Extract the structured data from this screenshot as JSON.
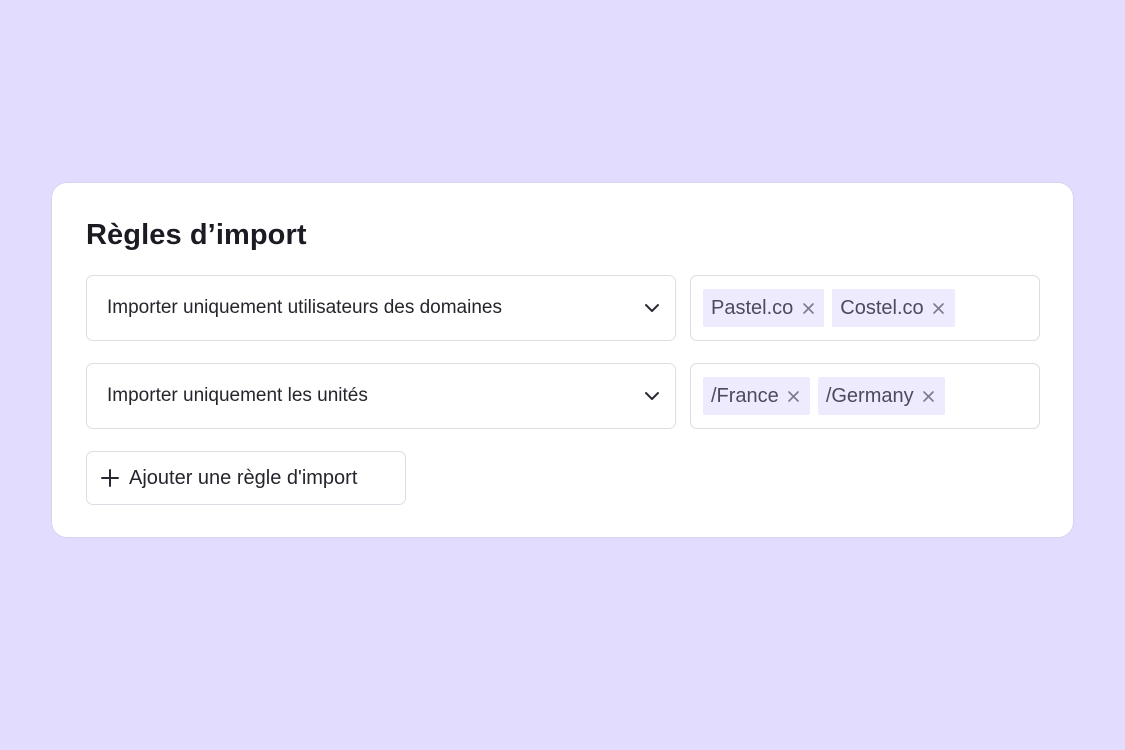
{
  "card": {
    "title": "Règles d’import"
  },
  "rules": [
    {
      "condition": "Importer uniquement utilisateurs des domaines",
      "tags": [
        "Pastel.co",
        "Costel.co"
      ]
    },
    {
      "condition": "Importer uniquement les unités",
      "tags": [
        "/France",
        "/Germany"
      ]
    }
  ],
  "add_rule_label": "Ajouter une règle d'import",
  "colors": {
    "background": "#e2dcfe",
    "tag_background": "#efebfe",
    "tag_text": "#4d4a5e",
    "border": "#dedde5"
  },
  "icons": {
    "chevron": "chevron-down-icon",
    "remove": "close-icon",
    "add": "plus-icon"
  }
}
